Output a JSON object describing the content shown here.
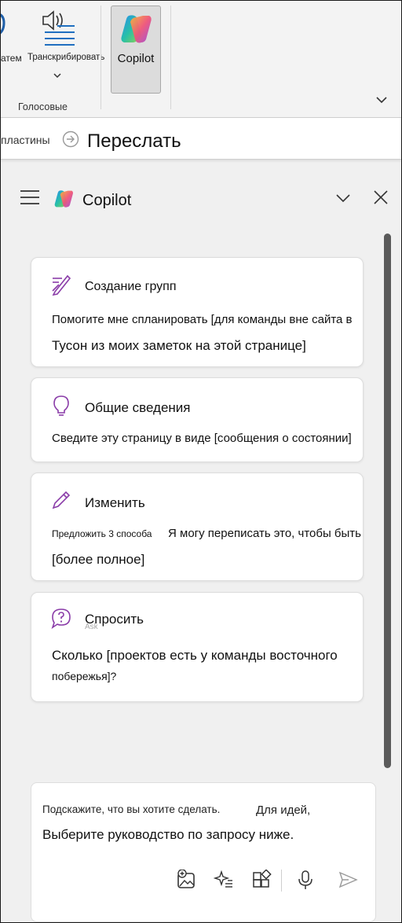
{
  "ribbon": {
    "dictate_label": "атем",
    "transcribe_label": "Транскрибировать",
    "group_label": "Голосовые",
    "copilot_label": "Copilot"
  },
  "strip": {
    "left_text": "пластины",
    "forward_label": "Переслать"
  },
  "pane": {
    "title": "Copilot"
  },
  "cards": [
    {
      "icon": "pencil-note-icon",
      "title": "Создание групп",
      "line1": "Помогите мне спланировать [для команды вне сайта в",
      "line2": "Тусон из моих заметок на этой странице]"
    },
    {
      "icon": "lightbulb-icon",
      "title": "Общие сведения",
      "line1": "Сведите эту страницу в виде [сообщения о состоянии]"
    },
    {
      "icon": "pencil-icon",
      "title": "Изменить",
      "line1a": "Предложить 3 способа",
      "line1b": "Я могу переписать это, чтобы быть",
      "line2": "[более полное]"
    },
    {
      "icon": "question-bubble-icon",
      "title": "Спросить",
      "title_ghost": "Ask",
      "line1": "Сколько [проектов есть у команды восточного",
      "line2": "побережья]?"
    }
  ],
  "input": {
    "hint_a": "Подскажите, что вы хотите сделать.",
    "hint_b": "Для идей,",
    "hint_c": "Выберите руководство по запросу ниже."
  },
  "colors": {
    "accent_purple": "#8a3ca8",
    "scroll_thumb": "#5a5a5a",
    "active_button_bg": "#dcdcdc"
  }
}
